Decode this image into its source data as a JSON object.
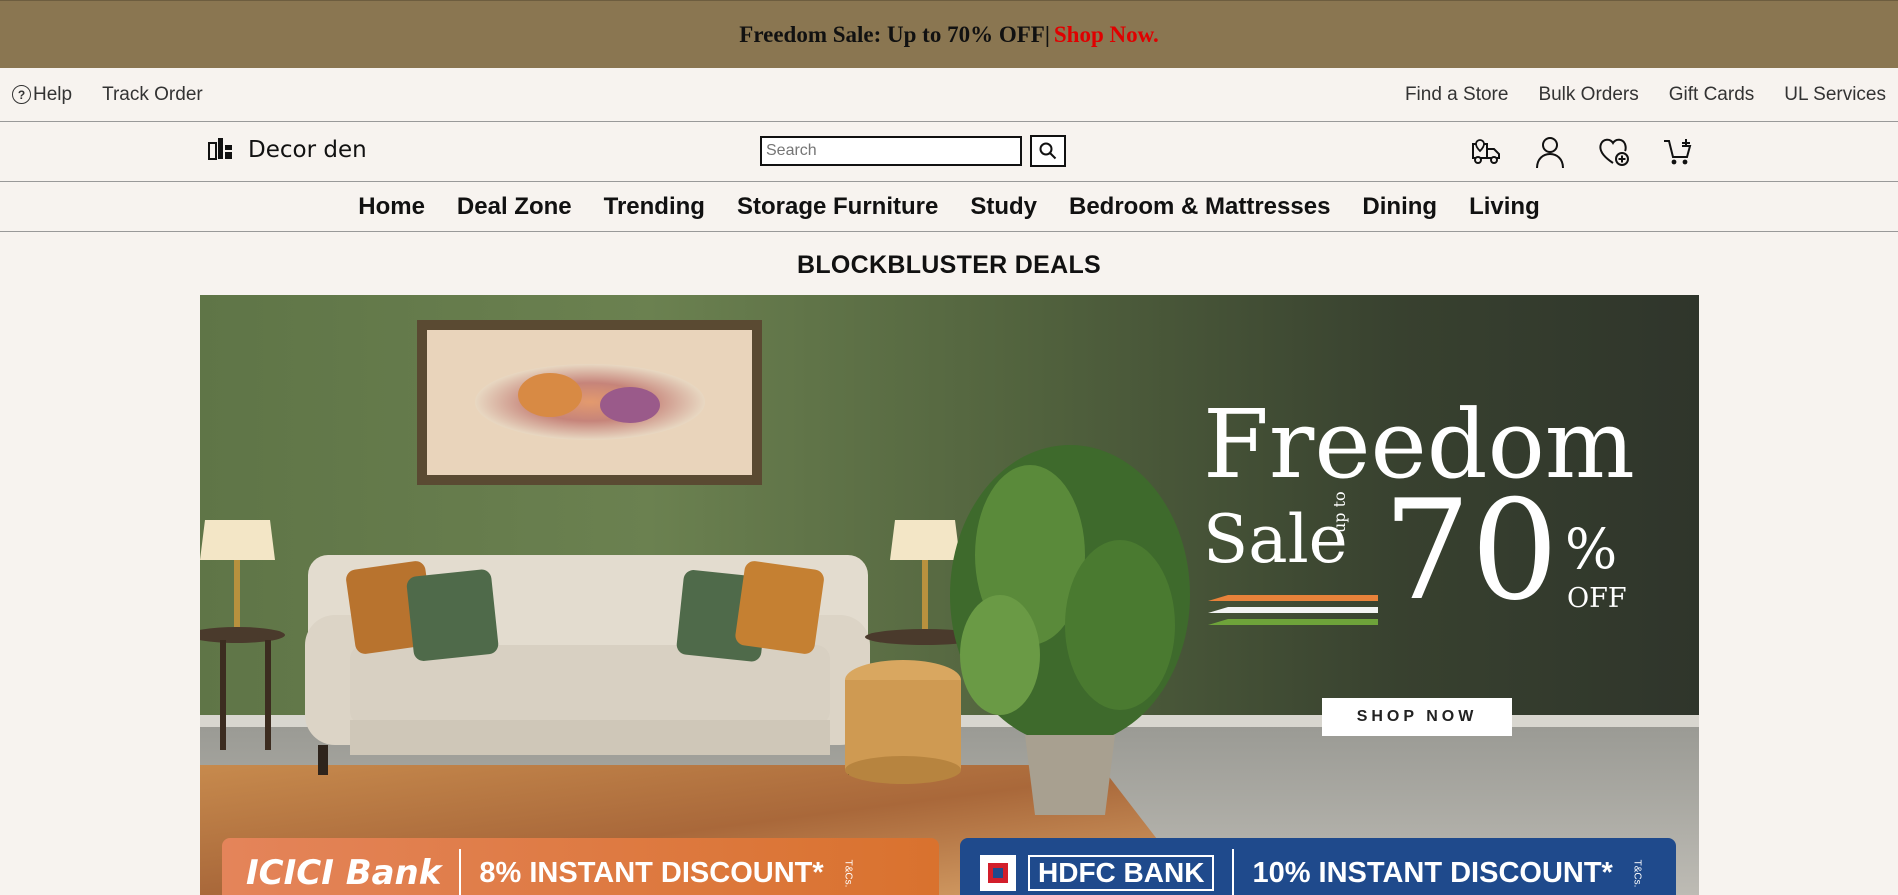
{
  "promo": {
    "text": "Freedom Sale: Up to 70% OFF|",
    "link": "Shop Now."
  },
  "util": {
    "left": [
      "Help",
      "Track Order"
    ],
    "right": [
      "Find a Store",
      "Bulk Orders",
      "Gift Cards",
      "UL Services"
    ]
  },
  "header": {
    "logo_text": "Decor den",
    "search_placeholder": "Search",
    "icons": [
      "delivery-truck-icon",
      "user-icon",
      "wishlist-heart-icon",
      "cart-icon"
    ]
  },
  "nav": [
    "Home",
    "Deal Zone",
    "Trending",
    "Storage Furniture",
    "Study",
    "Bedroom & Mattresses",
    "Dining",
    "Living"
  ],
  "section": {
    "title": "BLOCKBLUSTER DEALS"
  },
  "hero": {
    "line1": "Freedom",
    "line2": "Sale",
    "upto": "up to",
    "percent": "70",
    "percent_sign": "%",
    "off": "OFF",
    "cta": "SHOP NOW",
    "bank1_name": "ICICI Bank",
    "bank1_offer": "8% INSTANT DISCOUNT*",
    "bank2_name": "HDFC BANK",
    "bank2_offer": "10% INSTANT DISCOUNT*",
    "tc": "T&Cs."
  },
  "colors": {
    "promo_bg": "#8a7651",
    "promo_link": "#e00000",
    "page_bg": "#f7f3ef",
    "icici": "#e07b3a",
    "hdfc": "#1f4a8c"
  }
}
